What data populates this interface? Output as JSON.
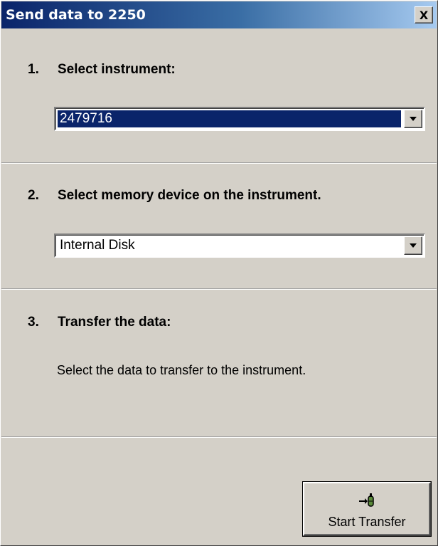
{
  "window": {
    "title": "Send data to 2250",
    "close_label": "X"
  },
  "steps": [
    {
      "number": "1.",
      "label": "Select instrument:"
    },
    {
      "number": "2.",
      "label": "Select memory device on the instrument."
    },
    {
      "number": "3.",
      "label": "Transfer the data:"
    }
  ],
  "instrument_select": {
    "value": "2479716",
    "arrow_icon": "chevron-down-icon"
  },
  "memory_select": {
    "value": "Internal Disk",
    "arrow_icon": "chevron-down-icon"
  },
  "transfer": {
    "description": "Select the data to transfer to the instrument.",
    "start_button_label": "Start Transfer",
    "button_icon": "transfer-to-device-icon"
  },
  "colors": {
    "titlebar_start": "#0a246a",
    "titlebar_end": "#a6caf0",
    "selection": "#0a246a",
    "face": "#d4d0c8"
  }
}
